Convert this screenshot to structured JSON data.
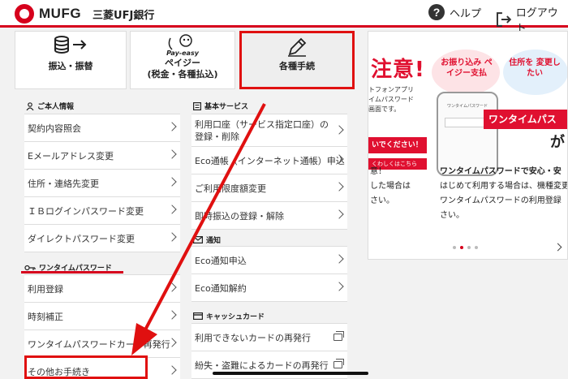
{
  "header": {
    "logo_text": "MUFG",
    "bank_name": "三菱UFJ銀行",
    "help_label": "ヘルプ",
    "help_icon_glyph": "?",
    "logout_label": "ログアウト",
    "accent_color": "#d6001c"
  },
  "tiles": {
    "transfer_label": "振込・振替",
    "payeasy_logo_text": "Pay-easy",
    "payeasy_label_line1": "ペイジー",
    "payeasy_label_line2": "(税金・各種払込)",
    "procedures_label": "各種手続"
  },
  "left_column": {
    "personal_info_header": "ご本人情報",
    "personal_items": [
      "契約内容照会",
      "Eメールアドレス変更",
      "住所・連絡先変更",
      "ＩＢログインパスワード変更",
      "ダイレクトパスワード変更"
    ],
    "otp_header": "ワンタイムパスワード",
    "otp_items": [
      "利用登録",
      "時刻補正",
      "ワンタイムパスワードカード再発行",
      "その他お手続き"
    ]
  },
  "middle_column": {
    "basic_services_header": "基本サービス",
    "basic_items": [
      "利用口座（サービス指定口座）の登録・削除",
      "Eco通帳（インターネット通帳）申込",
      "ご利用限度額変更",
      "即時振込の登録・解除"
    ],
    "notice_header": "通知",
    "notice_items": [
      "Eco通知申込",
      "Eco通知解約"
    ],
    "cash_card_header": "キャッシュカード",
    "card_items": [
      "利用できないカードの再発行",
      "紛失・盗難によるカードの再発行"
    ]
  },
  "banner": {
    "headline": "注意!",
    "bubble_left": "お振り込み ペイジー支払",
    "bubble_right": "住所を 変更したい",
    "small_note_line1": "トフォンアプリ",
    "small_note_line2": "イムパスワード",
    "small_note_line3": "画面です。",
    "phone_title": "ワンタイムパスワード",
    "otp_ribbon": "ワンタイムパス",
    "ga_text": "が",
    "red_strip": "いでください！",
    "detail_strip": "くわしくはこちら",
    "left_text_line1": "意！",
    "left_text_line2": "した場合は",
    "left_text_line3": "さい。",
    "right_title": "ワンタイムパスワードで安心・安",
    "right_line1": "はじめて利用する場合は、機種変更",
    "right_line2": "ワンタイムパスワードの利用登録",
    "right_line3": "さい。",
    "active_dot_index": 1,
    "dot_count": 4
  }
}
